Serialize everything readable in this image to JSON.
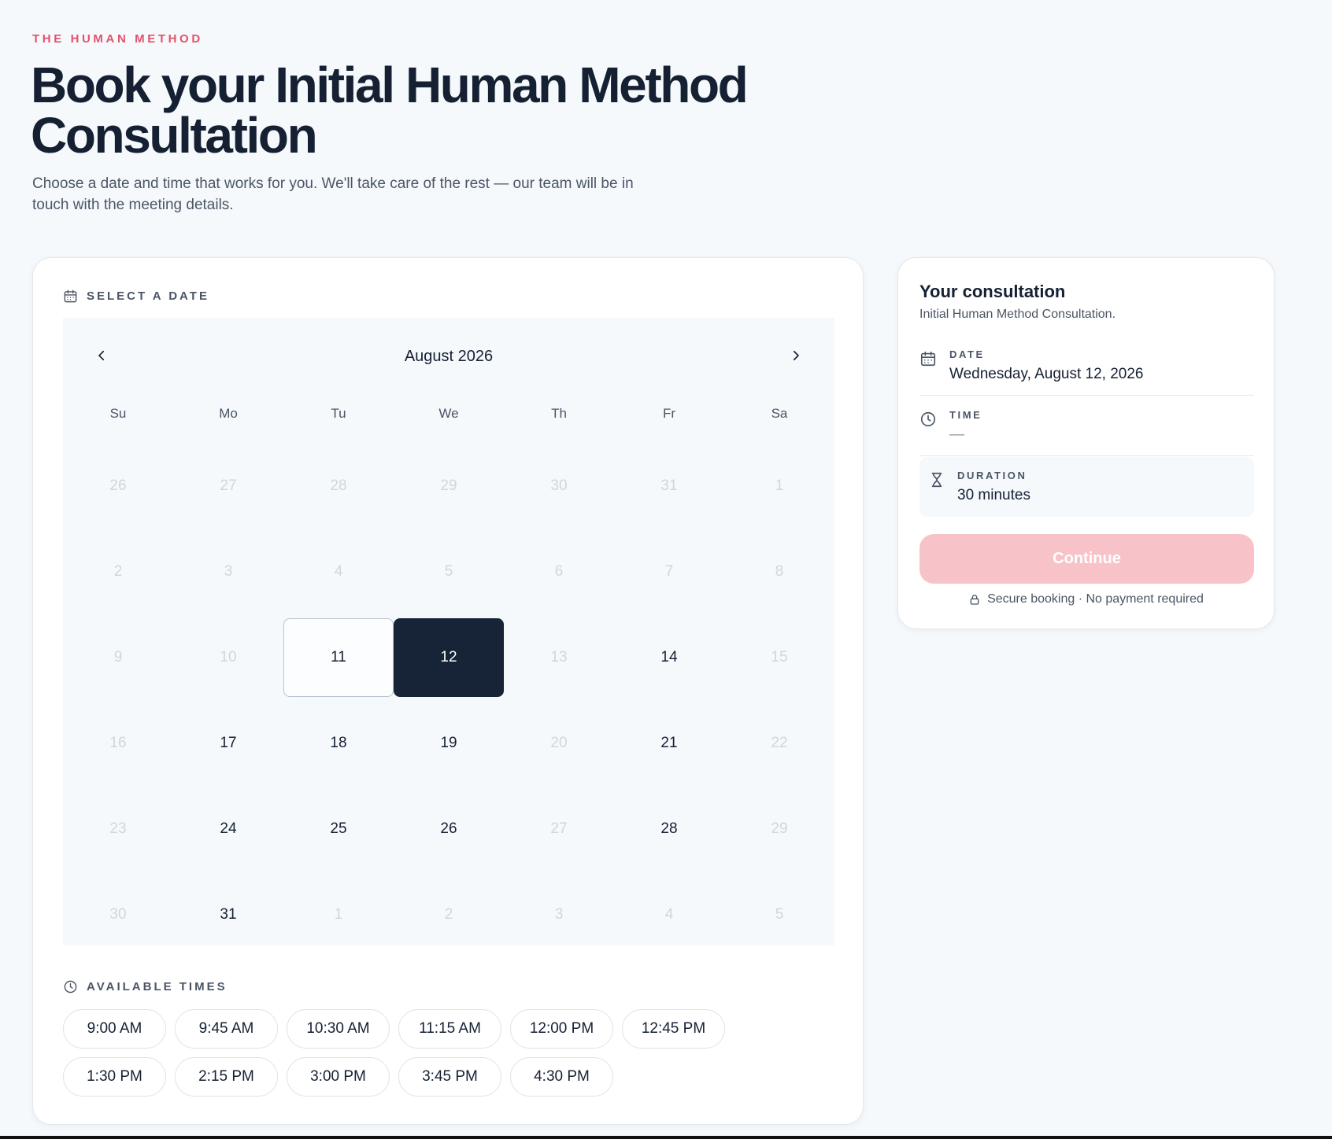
{
  "header": {
    "eyebrow": "THE HUMAN METHOD",
    "title": "Book your Initial Human Method Consultation",
    "subtitle": "Choose a date and time that works for you. We'll take care of the rest — our team will be in touch with the meeting details."
  },
  "date_section": {
    "heading": "SELECT A DATE",
    "month_label": "August 2026",
    "prev_icon": "chevron-left-icon",
    "next_icon": "chevron-right-icon",
    "weekdays": [
      "Su",
      "Mo",
      "Tu",
      "We",
      "Th",
      "Fr",
      "Sa"
    ],
    "weeks": [
      [
        {
          "d": "26",
          "muted": true
        },
        {
          "d": "27",
          "muted": true
        },
        {
          "d": "28",
          "muted": true
        },
        {
          "d": "29",
          "muted": true
        },
        {
          "d": "30",
          "muted": true
        },
        {
          "d": "31",
          "muted": true
        },
        {
          "d": "1",
          "muted": true
        }
      ],
      [
        {
          "d": "2",
          "muted": true
        },
        {
          "d": "3",
          "muted": true
        },
        {
          "d": "4",
          "muted": true
        },
        {
          "d": "5",
          "muted": true
        },
        {
          "d": "6",
          "muted": true
        },
        {
          "d": "7",
          "muted": true
        },
        {
          "d": "8",
          "muted": true
        }
      ],
      [
        {
          "d": "9",
          "muted": true
        },
        {
          "d": "10",
          "muted": true
        },
        {
          "d": "11",
          "state": "today"
        },
        {
          "d": "12",
          "state": "selected"
        },
        {
          "d": "13",
          "muted": true
        },
        {
          "d": "14"
        },
        {
          "d": "15",
          "muted": true
        }
      ],
      [
        {
          "d": "16",
          "muted": true
        },
        {
          "d": "17"
        },
        {
          "d": "18"
        },
        {
          "d": "19"
        },
        {
          "d": "20",
          "muted": true
        },
        {
          "d": "21"
        },
        {
          "d": "22",
          "muted": true
        }
      ],
      [
        {
          "d": "23",
          "muted": true
        },
        {
          "d": "24"
        },
        {
          "d": "25"
        },
        {
          "d": "26"
        },
        {
          "d": "27",
          "muted": true
        },
        {
          "d": "28"
        },
        {
          "d": "29",
          "muted": true
        }
      ],
      [
        {
          "d": "30",
          "muted": true
        },
        {
          "d": "31"
        },
        {
          "d": "1",
          "muted": true
        },
        {
          "d": "2",
          "muted": true
        },
        {
          "d": "3",
          "muted": true
        },
        {
          "d": "4",
          "muted": true
        },
        {
          "d": "5",
          "muted": true
        }
      ]
    ]
  },
  "times_section": {
    "heading": "AVAILABLE TIMES",
    "slots": [
      "9:00 AM",
      "9:45 AM",
      "10:30 AM",
      "11:15 AM",
      "12:00 PM",
      "12:45 PM",
      "1:30 PM",
      "2:15 PM",
      "3:00 PM",
      "3:45 PM",
      "4:30 PM"
    ]
  },
  "summary": {
    "title": "Your consultation",
    "subtitle": "Initial Human Method Consultation.",
    "date_label": "DATE",
    "date_value": "Wednesday, August 12, 2026",
    "time_label": "TIME",
    "time_value": "—",
    "duration_label": "DURATION",
    "duration_value": "30 minutes",
    "continue_label": "Continue",
    "secure_text": "Secure booking · No payment required"
  },
  "colors": {
    "accent": "#e4526a",
    "selected_day": "#172336",
    "continue_disabled": "#f7c3c8",
    "page_bg": "#f5f9fc"
  }
}
